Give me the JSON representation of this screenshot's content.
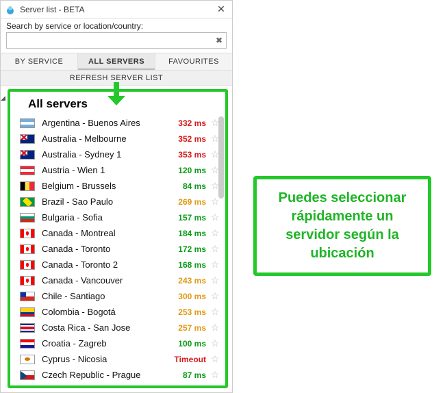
{
  "window": {
    "title": "Server list - BETA"
  },
  "search": {
    "label": "Search by service or location/country:",
    "value": "",
    "placeholder": ""
  },
  "tabs": {
    "by_service": "BY SERVICE",
    "all_servers": "ALL SERVERS",
    "favourites": "FAVOURITES",
    "selected": "all_servers"
  },
  "refresh": "REFRESH SERVER LIST",
  "section_title": "All servers",
  "servers": [
    {
      "flag": "ar",
      "name": "Argentina - Buenos Aires",
      "ping": "332 ms",
      "color": "red"
    },
    {
      "flag": "au",
      "name": "Australia - Melbourne",
      "ping": "352 ms",
      "color": "red"
    },
    {
      "flag": "au",
      "name": "Australia - Sydney 1",
      "ping": "353 ms",
      "color": "red"
    },
    {
      "flag": "at",
      "name": "Austria - Wien 1",
      "ping": "120 ms",
      "color": "green"
    },
    {
      "flag": "be",
      "name": "Belgium - Brussels",
      "ping": "84 ms",
      "color": "green"
    },
    {
      "flag": "br",
      "name": "Brazil - Sao Paulo",
      "ping": "269 ms",
      "color": "orange"
    },
    {
      "flag": "bg",
      "name": "Bulgaria - Sofia",
      "ping": "157 ms",
      "color": "green"
    },
    {
      "flag": "ca",
      "name": "Canada - Montreal",
      "ping": "184 ms",
      "color": "green"
    },
    {
      "flag": "ca",
      "name": "Canada - Toronto",
      "ping": "172 ms",
      "color": "green"
    },
    {
      "flag": "ca",
      "name": "Canada - Toronto 2",
      "ping": "168 ms",
      "color": "green"
    },
    {
      "flag": "ca",
      "name": "Canada - Vancouver",
      "ping": "243 ms",
      "color": "orange"
    },
    {
      "flag": "cl",
      "name": "Chile - Santiago",
      "ping": "300 ms",
      "color": "orange"
    },
    {
      "flag": "co",
      "name": "Colombia - Bogotá",
      "ping": "253 ms",
      "color": "orange"
    },
    {
      "flag": "cr",
      "name": "Costa Rica - San Jose",
      "ping": "257 ms",
      "color": "orange"
    },
    {
      "flag": "hr",
      "name": "Croatia - Zagreb",
      "ping": "100 ms",
      "color": "green"
    },
    {
      "flag": "cy",
      "name": "Cyprus - Nicosia",
      "ping": "Timeout",
      "color": "red"
    },
    {
      "flag": "cz",
      "name": "Czech Republic - Prague",
      "ping": "87 ms",
      "color": "green"
    }
  ],
  "callout": "Puedes seleccionar rápidamente un servidor según la ubicación"
}
